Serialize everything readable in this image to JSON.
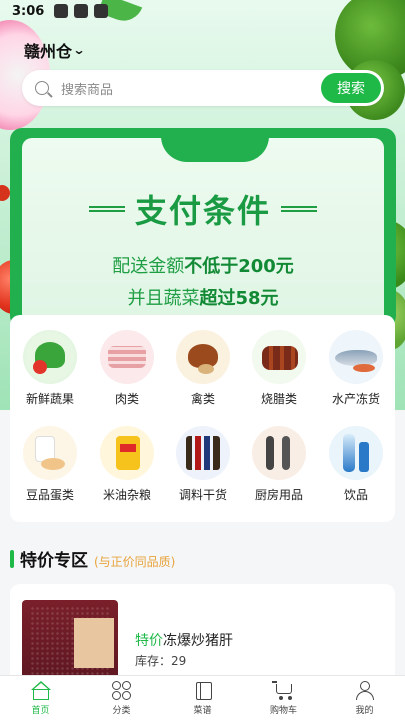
{
  "status_bar": {
    "time": "3:06"
  },
  "location": {
    "name": "赣州仓"
  },
  "search": {
    "placeholder": "搜索商品",
    "button": "搜索"
  },
  "promo": {
    "title": "支付条件",
    "line1_prefix": "配送金额",
    "line1_em": "不低于200元",
    "line2_prefix": "并且蔬菜",
    "line2_em": "超过58元"
  },
  "categories": [
    {
      "label": "新鲜蔬果",
      "icon": "vegetables-icon"
    },
    {
      "label": "肉类",
      "icon": "meat-icon"
    },
    {
      "label": "禽类",
      "icon": "poultry-icon"
    },
    {
      "label": "烧腊类",
      "icon": "cured-meat-icon"
    },
    {
      "label": "水产冻货",
      "icon": "seafood-icon"
    },
    {
      "label": "豆品蛋类",
      "icon": "soy-eggs-icon"
    },
    {
      "label": "米油杂粮",
      "icon": "rice-oil-icon"
    },
    {
      "label": "调料干货",
      "icon": "seasoning-icon"
    },
    {
      "label": "厨房用品",
      "icon": "kitchenware-icon"
    },
    {
      "label": "饮品",
      "icon": "drinks-icon"
    }
  ],
  "specials": {
    "title": "特价专区",
    "subtitle": "(与正价同品质)",
    "products": [
      {
        "tag": "特价",
        "name": "冻爆炒猪肝",
        "stock_label": "库存：",
        "stock": "29"
      }
    ]
  },
  "tabbar": [
    {
      "label": "首页",
      "icon": "home-icon",
      "active": true
    },
    {
      "label": "分类",
      "icon": "category-icon",
      "active": false
    },
    {
      "label": "菜谱",
      "icon": "recipe-icon",
      "active": false
    },
    {
      "label": "购物车",
      "icon": "cart-icon",
      "active": false
    },
    {
      "label": "我的",
      "icon": "user-icon",
      "active": false
    }
  ],
  "colors": {
    "brand": "#1fb948",
    "promo_green": "#22b04f",
    "accent_orange": "#e8a33a"
  }
}
